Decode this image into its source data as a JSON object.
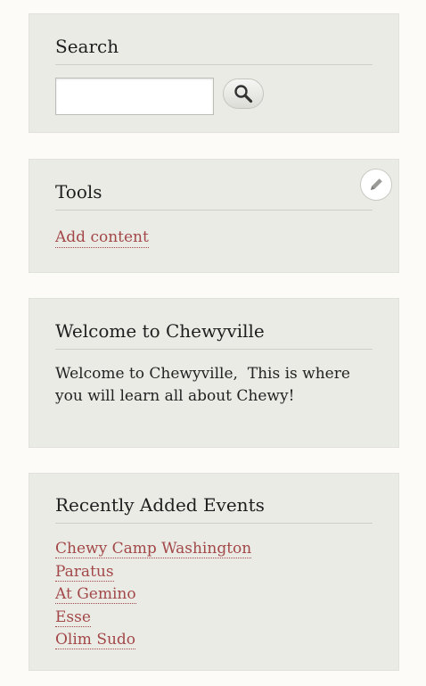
{
  "search": {
    "title": "Search",
    "input_value": "",
    "button_icon": "magnifier-icon"
  },
  "tools": {
    "title": "Tools",
    "edit_icon": "pencil-icon",
    "links": [
      "Add content"
    ]
  },
  "welcome": {
    "title": "Welcome to Chewyville",
    "body": "Welcome to Chewyville,  This is where you will learn all about Chewy!"
  },
  "events": {
    "title": "Recently Added Events",
    "items": [
      "Chewy Camp Washington",
      "Paratus",
      "At Gemino",
      "Esse",
      "Olim Sudo"
    ]
  },
  "colors": {
    "page_background": "#fcfbf7",
    "block_background": "#ebebe6",
    "link": "#a24848",
    "text": "#222222"
  }
}
